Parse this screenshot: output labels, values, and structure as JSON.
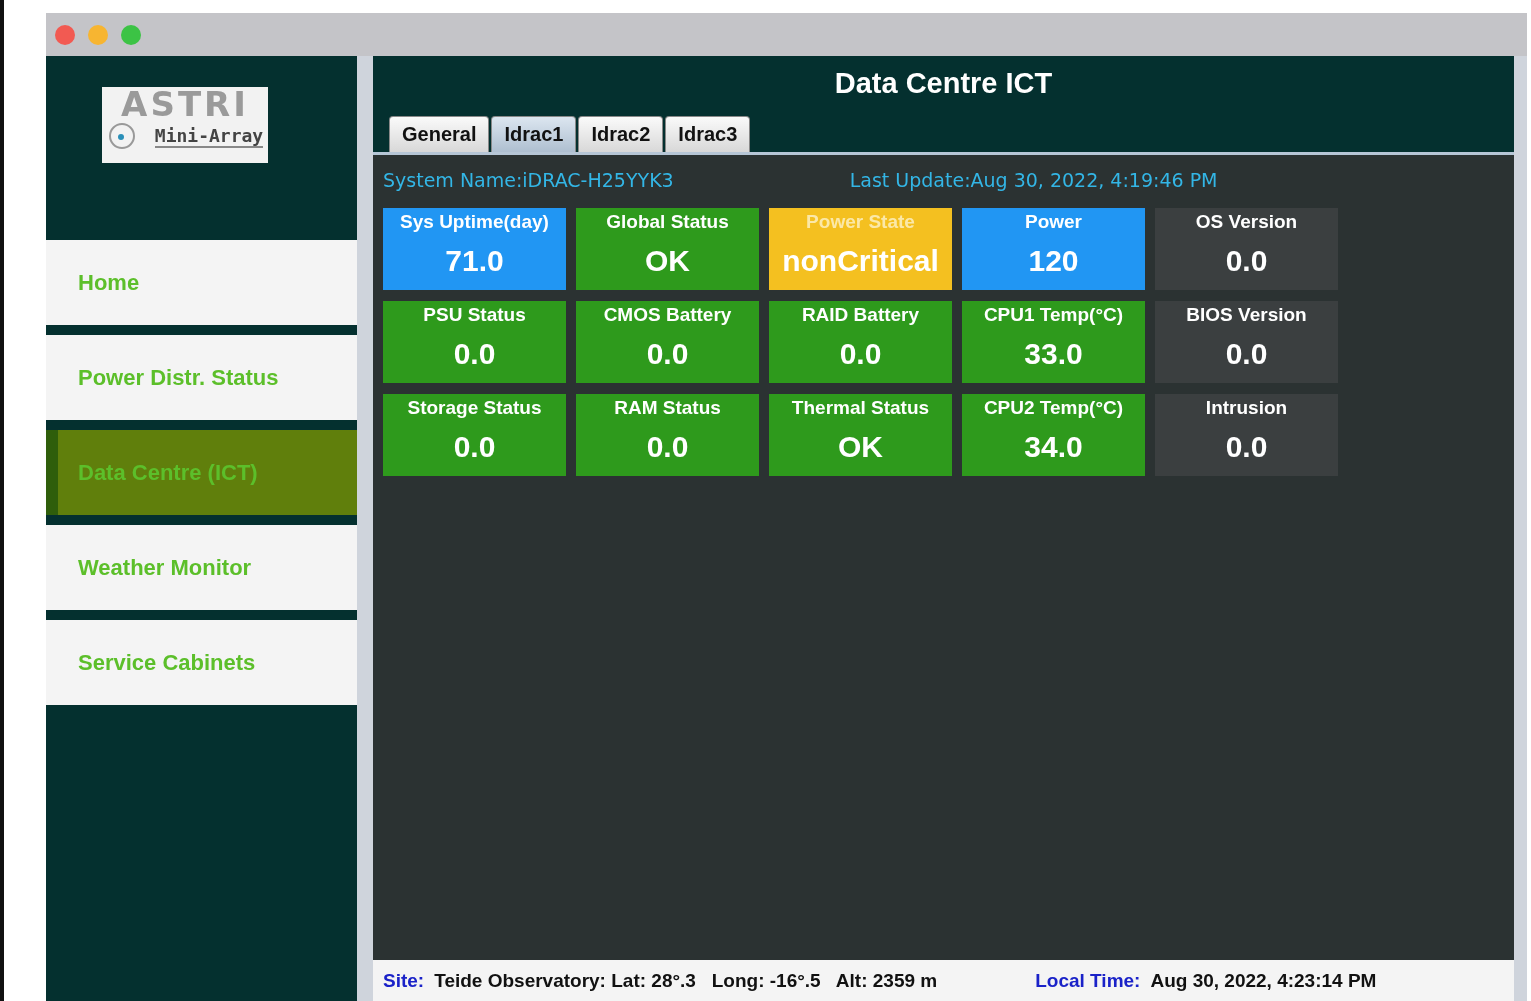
{
  "window": {
    "title": "Data Centre ICT"
  },
  "logo": {
    "mark": "ASTRI",
    "caption": "Mini-Array"
  },
  "sidebar": {
    "items": [
      {
        "label": "Home",
        "selected": false
      },
      {
        "label": "Power Distr. Status",
        "selected": false
      },
      {
        "label": "Data Centre (ICT)",
        "selected": true
      },
      {
        "label": "Weather Monitor",
        "selected": false
      },
      {
        "label": "Service Cabinets",
        "selected": false
      }
    ]
  },
  "tabs": [
    {
      "label": "General",
      "selected": false
    },
    {
      "label": "Idrac1",
      "selected": true
    },
    {
      "label": "Idrac2",
      "selected": false
    },
    {
      "label": "Idrac3",
      "selected": false
    }
  ],
  "info": {
    "system_name": "System Name:iDRAC-H25YYK3",
    "last_update": "Last Update:Aug 30, 2022, 4:19:46 PM"
  },
  "tiles": [
    {
      "label": "Sys Uptime(day)",
      "value": "71.0",
      "color": "#2196f3"
    },
    {
      "label": "Global Status",
      "value": "OK",
      "color": "#2e9a1c"
    },
    {
      "label": "Power State",
      "value": "nonCritical",
      "color": "#f4c020"
    },
    {
      "label": "Power",
      "value": "120",
      "color": "#2196f3"
    },
    {
      "label": "OS Version",
      "value": "0.0",
      "color": "#3b3f40"
    },
    {
      "label": "PSU Status",
      "value": "0.0",
      "color": "#2e9a1c"
    },
    {
      "label": "CMOS Battery",
      "value": "0.0",
      "color": "#2e9a1c"
    },
    {
      "label": "RAID Battery",
      "value": "0.0",
      "color": "#2e9a1c"
    },
    {
      "label": "CPU1 Temp(°C)",
      "value": "33.0",
      "color": "#2e9a1c"
    },
    {
      "label": "BIOS Version",
      "value": "0.0",
      "color": "#3b3f40"
    },
    {
      "label": "Storage Status",
      "value": "0.0",
      "color": "#2e9a1c"
    },
    {
      "label": "RAM Status",
      "value": "0.0",
      "color": "#2e9a1c"
    },
    {
      "label": "Thermal Status",
      "value": "OK",
      "color": "#2e9a1c"
    },
    {
      "label": "CPU2 Temp(°C)",
      "value": "34.0",
      "color": "#2e9a1c"
    },
    {
      "label": "Intrusion",
      "value": "0.0",
      "color": "#3b3f40"
    }
  ],
  "status_bar": {
    "site_label": "Site:",
    "site": "Teide Observatory: Lat: 28°.3   Long: -16°.5   Alt: 2359 m",
    "time_label": "Local Time:",
    "time": "Aug 30, 2022, 4:23:14 PM"
  }
}
